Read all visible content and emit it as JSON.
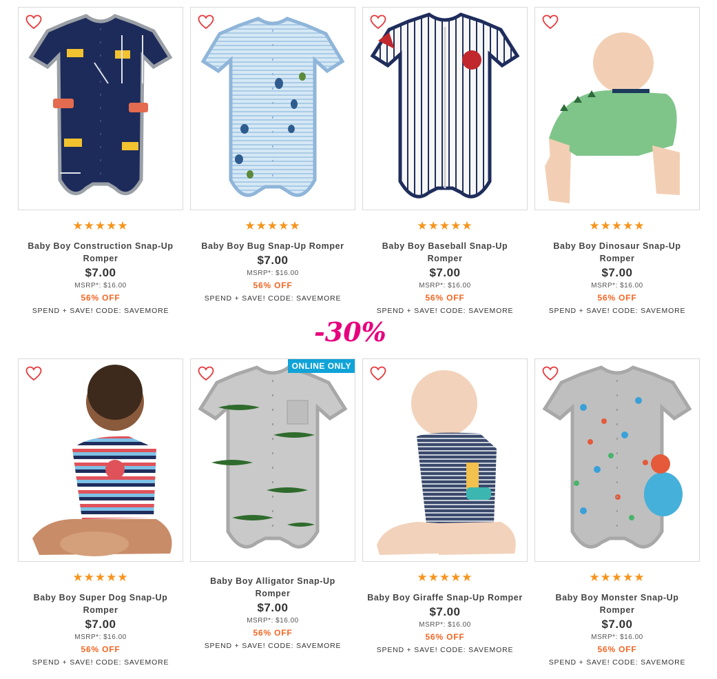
{
  "discount_overlay": "-30%",
  "colors": {
    "star": "#f7941d",
    "off": "#f26522",
    "heart": "#e8373a",
    "badge": "#10a3d8",
    "overlay": "#e6007e"
  },
  "icons": {
    "wishlist": "heart-outline-icon",
    "rating": "star-icon"
  },
  "products": [
    {
      "stars": "★★★★★",
      "name": "Baby Boy Construction Snap-Up Romper",
      "price": "$7.00",
      "msrp": "MSRP*: $16.00",
      "off": "56% OFF",
      "promo": "SPEND + SAVE! CODE: SAVEMORE"
    },
    {
      "stars": "★★★★★",
      "name": "Baby Boy Bug Snap-Up Romper",
      "price": "$7.00",
      "msrp": "MSRP*: $16.00",
      "off": "56% OFF",
      "promo": "SPEND + SAVE! CODE: SAVEMORE"
    },
    {
      "stars": "★★★★★",
      "name": "Baby Boy Baseball Snap-Up Romper",
      "price": "$7.00",
      "msrp": "MSRP*: $16.00",
      "off": "56% OFF",
      "promo": "SPEND + SAVE! CODE: SAVEMORE"
    },
    {
      "stars": "★★★★★",
      "name": "Baby Boy Dinosaur Snap-Up Romper",
      "price": "$7.00",
      "msrp": "MSRP*: $16.00",
      "off": "56% OFF",
      "promo": "SPEND + SAVE! CODE: SAVEMORE"
    },
    {
      "stars": "★★★★★",
      "name": "Baby Boy Super Dog Snap-Up Romper",
      "price": "$7.00",
      "msrp": "MSRP*: $16.00",
      "off": "56% OFF",
      "promo": "SPEND + SAVE! CODE: SAVEMORE"
    },
    {
      "badge": "ONLINE ONLY",
      "name": "Baby Boy Alligator Snap-Up Romper",
      "price": "$7.00",
      "msrp": "MSRP*: $16.00",
      "off": "56% OFF",
      "promo": "SPEND + SAVE! CODE: SAVEMORE"
    },
    {
      "stars": "★★★★★",
      "name": "Baby Boy Giraffe Snap-Up Romper",
      "price": "$7.00",
      "msrp": "MSRP*: $16.00",
      "off": "56% OFF",
      "promo": "SPEND + SAVE! CODE: SAVEMORE"
    },
    {
      "stars": "★★★★★",
      "name": "Baby Boy Monster Snap-Up Romper",
      "price": "$7.00",
      "msrp": "MSRP*: $16.00",
      "off": "56% OFF",
      "promo": "SPEND + SAVE! CODE: SAVEMORE"
    }
  ]
}
